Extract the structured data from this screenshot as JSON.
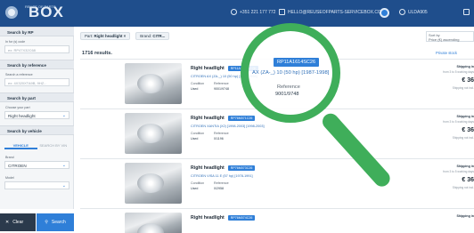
{
  "header": {
    "logo_small": "REUSE OF PARTS",
    "logo_big": "BOX",
    "phone": "+351 221 177 772",
    "email": "HELLO@REUSEOFPARTS-SERVICEBOX.COM",
    "account": "ULDA905"
  },
  "sidebar": {
    "search_ref_title": "Search by RP",
    "rp_label": "In for (s) code",
    "rp_placeholder": "ex: RP47X32C68",
    "search_reference_title": "Search by reference",
    "reference_label": "Search a reference",
    "reference_placeholder": "ex: 4X320XTA9B, 9HZ...",
    "search_part_title": "Search by part",
    "part_label": "Choose your part",
    "part_value": "Right headlight",
    "search_vehicle_title": "Search by vehicle",
    "tab_vehicle": "VEHICLE",
    "tab_plate": "SEARCH BY VIN",
    "brand_label": "Brand",
    "brand_value": "CITROEN",
    "model_label": "Model",
    "model_value": "",
    "clear_label": "Clear",
    "search_label": "Search"
  },
  "main": {
    "chip_part_key": "Part:",
    "chip_part_value": "Right headlight ×",
    "chip_brand_key": "Brand:",
    "chip_brand_value": "CITR...",
    "sort_label": "Sort by",
    "sort_value": "Price (€) ascending",
    "results_count": "1716 results.",
    "private_link": "Private stock",
    "results": [
      {
        "title": "Right headlight",
        "ref_badge": "RP11A1614SC26",
        "car": "CITROEN AX (ZA-_) 10 (50 hp) [1987-1998]",
        "condition_label": "Condition",
        "condition_value": "Used",
        "reference_label": "Reference",
        "reference_value": "9001/9748",
        "shipping_label": "Shipping in",
        "delay": "from 3 to 5 working days",
        "price": "€ 36",
        "note": "Shipping not incl."
      },
      {
        "title": "Right headlight",
        "ref_badge": "RP76M071C26",
        "car": "CITROEN XANTIA (X2) [1998-2003] [1998-2003]",
        "condition_label": "Condition",
        "condition_value": "Used",
        "reference_label": "Reference",
        "reference_value": "0/1196",
        "shipping_label": "Shipping in",
        "delay": "from 3 to 5 working days",
        "price": "€ 36",
        "note": "Shipping not incl."
      },
      {
        "title": "Right headlight",
        "ref_badge": "RP76M073C26",
        "car": "CITROEN VISA 11 E (57 hp) [1978-1991]",
        "condition_label": "Condition",
        "condition_value": "Used",
        "reference_label": "Reference",
        "reference_value": "0/2958",
        "shipping_label": "Shipping in",
        "delay": "from 3 to 5 working days",
        "price": "€ 36",
        "note": "Shipping not incl."
      },
      {
        "title": "Right headlight",
        "ref_badge": "RP76M074C26",
        "car": "",
        "condition_label": "",
        "condition_value": "",
        "reference_label": "",
        "reference_value": "",
        "shipping_label": "Shipping in",
        "delay": "",
        "price": "",
        "note": ""
      }
    ]
  },
  "magnifier": {
    "ref_badge": "RP11A1614SC26",
    "car": "AX (ZA-_) 10 (50 hp) [1987-1998]",
    "reference_label": "Reference",
    "reference_value": "9001/9748"
  }
}
